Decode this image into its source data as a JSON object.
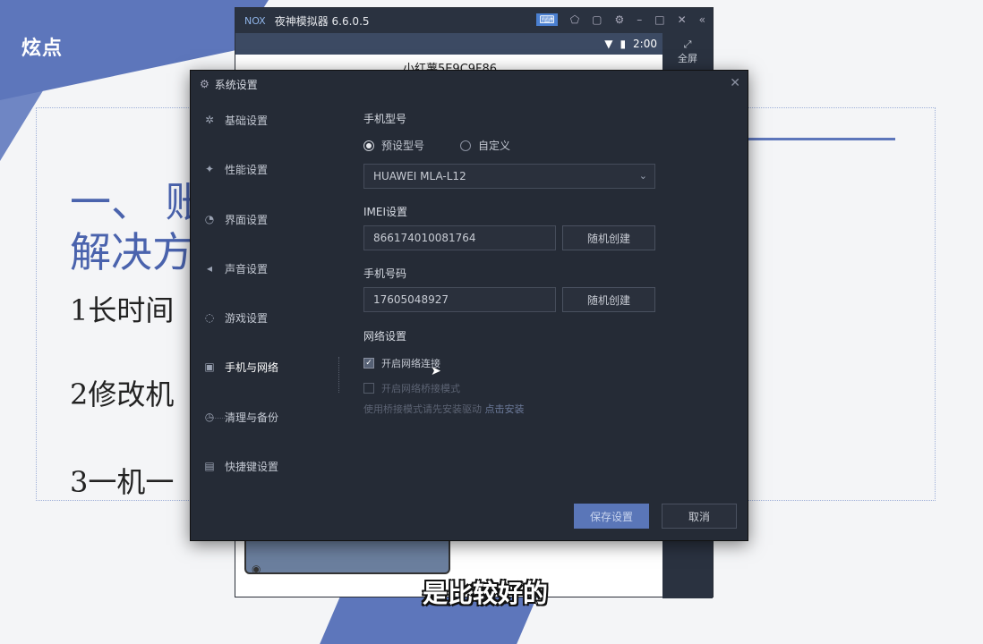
{
  "slide": {
    "brand": "炫点",
    "title_line1": "一、 账",
    "title_line2": "解决方",
    "item1": "1长时间",
    "item2": "2修改机",
    "item3": "3一机一"
  },
  "subtitle": "是比较好的",
  "emulator": {
    "logo": "NOX",
    "title": "夜神模拟器 6.6.0.5",
    "status_time": "2:00",
    "app_title": "小红薯5E9C9F86",
    "fullscreen_label": "全屏"
  },
  "dialog": {
    "title": "系统设置",
    "nav": [
      {
        "label": "基础设置",
        "icon": "gear-icon"
      },
      {
        "label": "性能设置",
        "icon": "spark-icon"
      },
      {
        "label": "界面设置",
        "icon": "display-icon"
      },
      {
        "label": "声音设置",
        "icon": "sound-icon"
      },
      {
        "label": "游戏设置",
        "icon": "game-icon"
      },
      {
        "label": "手机与网络",
        "icon": "phone-icon"
      },
      {
        "label": "清理与备份",
        "icon": "cleanup-icon"
      },
      {
        "label": "快捷键设置",
        "icon": "keyboard-icon"
      }
    ],
    "phone_model": {
      "heading": "手机型号",
      "option_preset": "预设型号",
      "option_custom": "自定义",
      "selected_model": "HUAWEI MLA-L12"
    },
    "imei": {
      "heading": "IMEI设置",
      "value": "866174010081764",
      "button": "随机创建"
    },
    "phone_number": {
      "heading": "手机号码",
      "value": "17605048927",
      "button": "随机创建"
    },
    "network": {
      "heading": "网络设置",
      "enable_label": "开启网络连接",
      "bridge_label": "开启网络桥接模式",
      "hint_text": "使用桥接模式请先安装驱动",
      "hint_link": "点击安装"
    },
    "save_label": "保存设置",
    "cancel_label": "取消"
  }
}
